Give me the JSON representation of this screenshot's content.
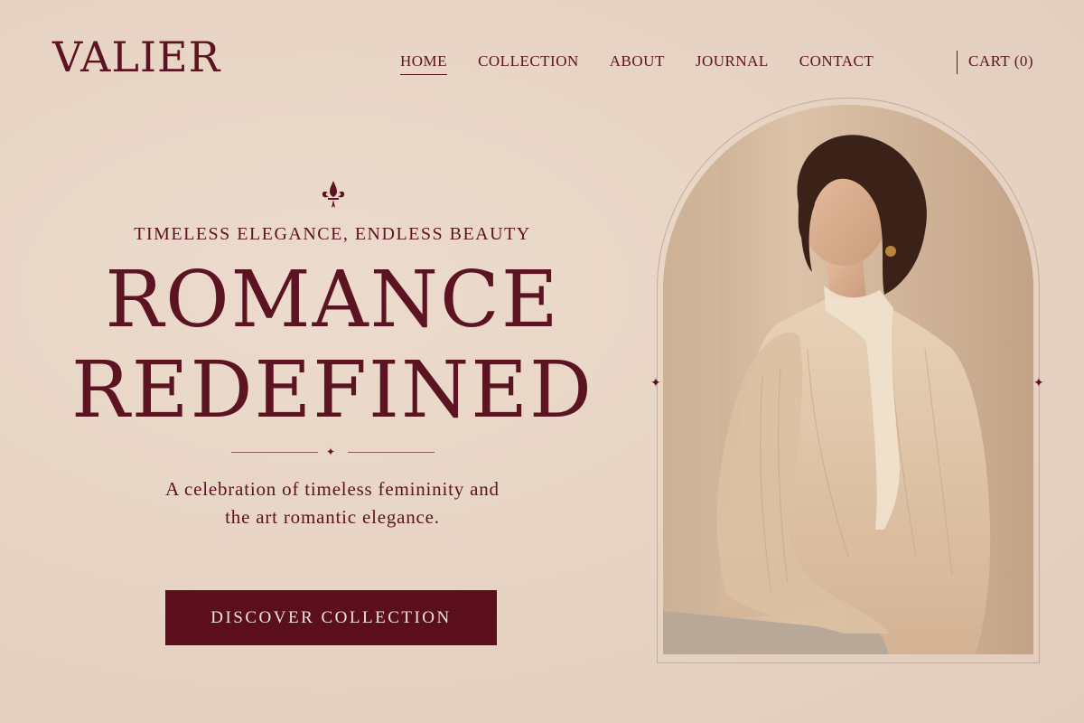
{
  "header": {
    "logo": "VALIER",
    "nav": [
      "HOME",
      "COLLECTION",
      "ABOUT",
      "JOURNAL",
      "CONTACT"
    ],
    "active_nav": "HOME",
    "cart": "CART (0)"
  },
  "hero": {
    "tagline": "TIMELESS ELEGANCE, ENDLESS  BEAUTY",
    "title_line1": "ROMANCE",
    "title_line2": "REDEFINED",
    "description_line1": "A celebration of timeless femininity and",
    "description_line2": "the art romantic elegance.",
    "cta_label": "DISCOVER COLLECTION"
  },
  "image": {
    "subject": "woman-portrait",
    "frame_shape": "arch"
  },
  "colors": {
    "background": "#e9d7c8",
    "accent": "#5b0f1c",
    "frame": "#c9a99a"
  },
  "icons": {
    "fleur": "fleur-de-lis-icon",
    "divider_star": "sparkle-icon",
    "frame_sparkle": "sparkle-icon"
  }
}
